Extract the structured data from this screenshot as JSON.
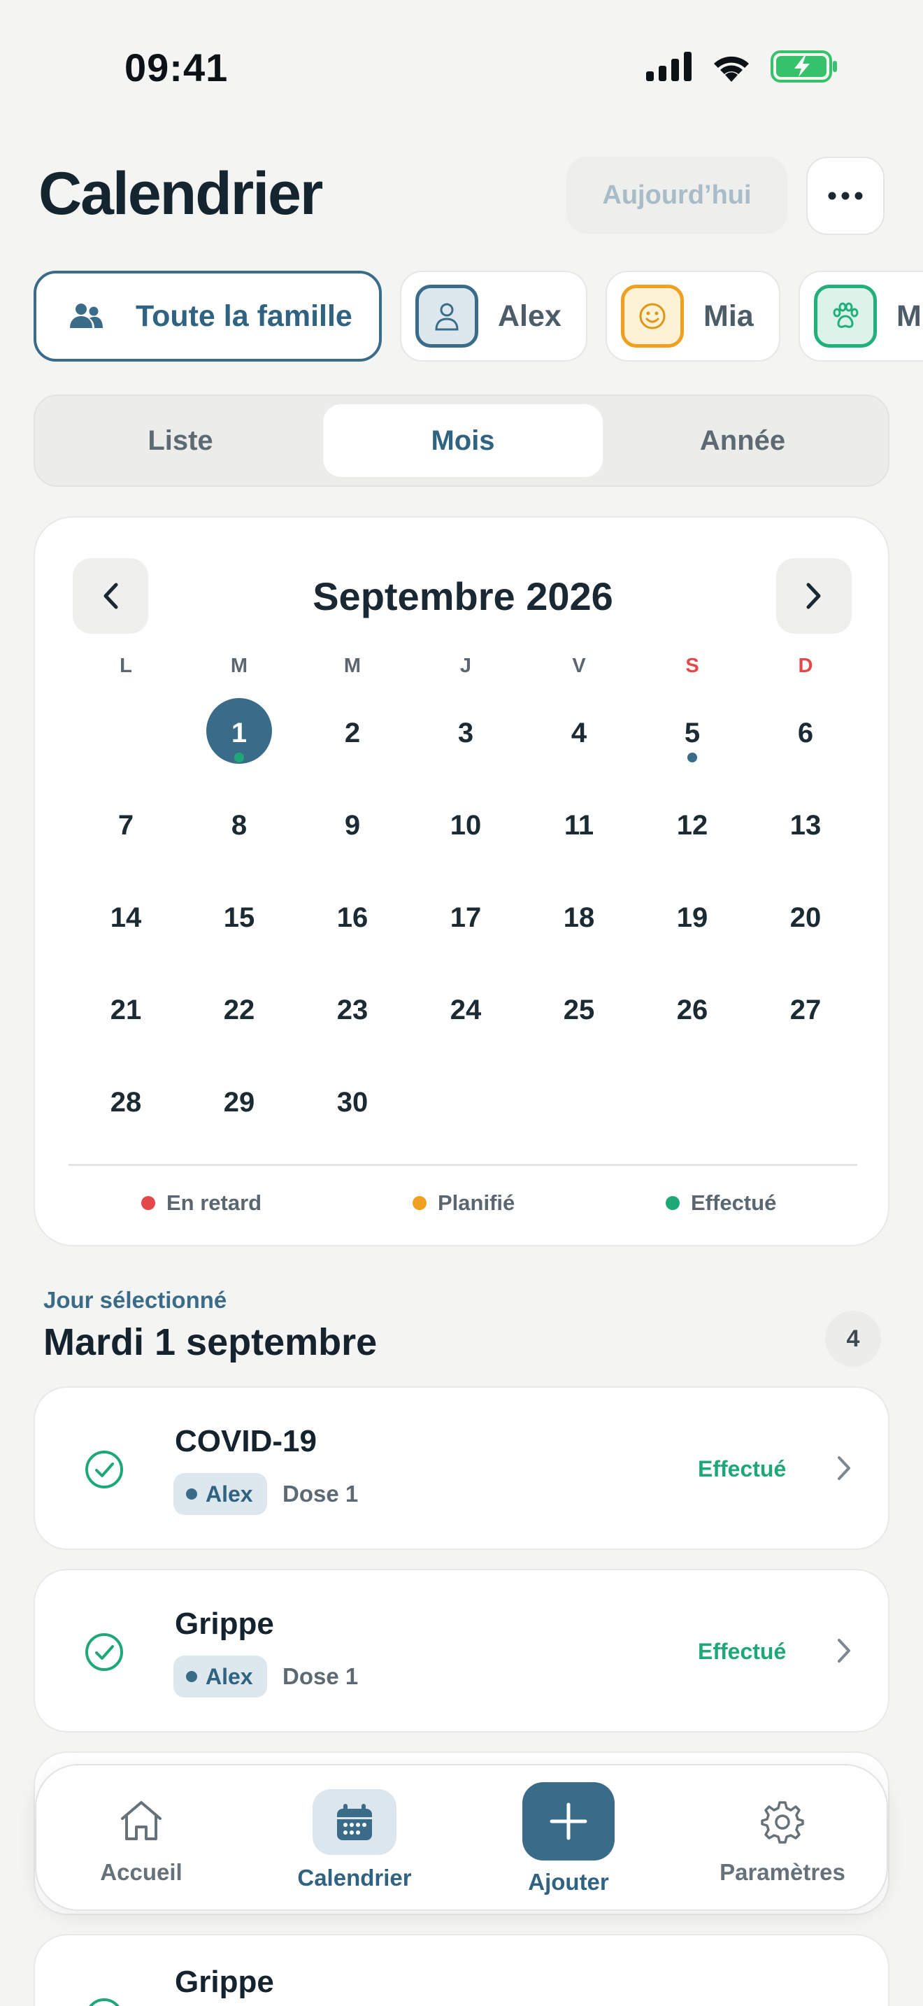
{
  "status_bar": {
    "time": "09:41"
  },
  "header": {
    "title": "Calendrier",
    "today_label": "Aujourd’hui"
  },
  "members": [
    {
      "label": "Toute la famille",
      "icon": "family-icon",
      "active": true
    },
    {
      "label": "Alex",
      "icon": "person-icon",
      "color": "#3a6c8a"
    },
    {
      "label": "Mia",
      "icon": "smiley-icon",
      "color": "#f0a020"
    },
    {
      "label": "M",
      "icon": "paw-icon",
      "color": "#22b07a"
    }
  ],
  "views": [
    {
      "label": "Liste"
    },
    {
      "label": "Mois",
      "active": true
    },
    {
      "label": "Année"
    }
  ],
  "calendar": {
    "month_title": "Septembre 2026",
    "weekdays": [
      "L",
      "M",
      "M",
      "J",
      "V",
      "S",
      "D"
    ],
    "selected_day": "1",
    "days": [
      "1",
      "2",
      "3",
      "4",
      "5",
      "6",
      "7",
      "8",
      "9",
      "10",
      "11",
      "12",
      "13",
      "14",
      "15",
      "16",
      "17",
      "18",
      "19",
      "20",
      "21",
      "22",
      "23",
      "24",
      "25",
      "26",
      "27",
      "28",
      "29",
      "30"
    ],
    "legend": {
      "late": "En retard",
      "planned": "Planifié",
      "done": "Effectué"
    },
    "colors": {
      "late": "#e54848",
      "planned": "#f0a020",
      "done": "#1ea877",
      "accent": "#3a6c8a"
    }
  },
  "selected": {
    "label": "Jour sélectionné",
    "date": "Mardi 1 septembre",
    "count": "4"
  },
  "events": [
    {
      "title": "COVID-19",
      "member": "Alex",
      "dose": "Dose 1",
      "status": "Effectué"
    },
    {
      "title": "Grippe",
      "member": "Alex",
      "dose": "Dose 1",
      "status": "Effectué"
    },
    {
      "title": "Grippe"
    }
  ],
  "bottom_nav": {
    "home": "Accueil",
    "calendar": "Calendrier",
    "add": "Ajouter",
    "settings": "Paramètres"
  }
}
